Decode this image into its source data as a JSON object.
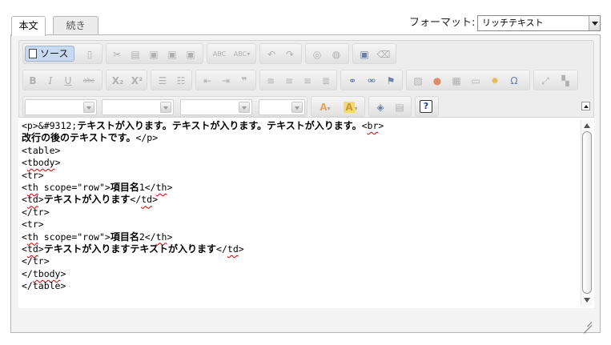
{
  "tabs": [
    {
      "label": "本文",
      "active": true
    },
    {
      "label": "続き",
      "active": false
    }
  ],
  "format": {
    "label": "フォーマット:",
    "selected": "リッチテキスト"
  },
  "toolbar": {
    "source_label": "ソース",
    "row1_icons": [
      "source-icon",
      "new-page-icon",
      "cut-icon",
      "copy-icon",
      "paste-icon",
      "paste-text-icon",
      "paste-word-icon",
      "spellcheck-icon",
      "spellcheck-options-icon",
      "undo-icon",
      "redo-icon",
      "find-icon",
      "replace-icon",
      "select-all-icon",
      "remove-format-icon"
    ],
    "row2_icons": [
      "bold-icon",
      "italic-icon",
      "underline-icon",
      "strikethrough-icon",
      "subscript-icon",
      "superscript-icon",
      "numbered-list-icon",
      "bullet-list-icon",
      "outdent-icon",
      "indent-icon",
      "blockquote-icon",
      "align-left-icon",
      "align-center-icon",
      "align-right-icon",
      "justify-icon",
      "link-icon",
      "unlink-icon",
      "anchor-icon",
      "image-icon",
      "flash-icon",
      "table-icon",
      "horizontal-rule-icon",
      "special-char-icon",
      "omega-icon",
      "maximize-icon",
      "show-blocks-icon"
    ],
    "row3_icons": [
      "text-color-icon",
      "bg-color-icon",
      "maximize2-icon",
      "show-blocks2-icon",
      "about-icon"
    ],
    "text_color_glyph": "A",
    "bg_color_glyph": "A",
    "about_glyph": "?",
    "omega_glyph": "Ω"
  },
  "source_lines": [
    [
      {
        "t": "<p>&#9312;"
      },
      {
        "t": "テキストが入ります。テキストが入ります。テキストが入ります。",
        "b": true
      },
      {
        "t": "<"
      },
      {
        "t": "br",
        "sq": true
      },
      {
        "t": ">"
      }
    ],
    [
      {
        "t": "改行の後のテキストです。",
        "b": true
      },
      {
        "t": "</p>"
      }
    ],
    [
      {
        "t": "<table>"
      }
    ],
    [
      {
        "t": "<"
      },
      {
        "t": "tbody",
        "sq": true
      },
      {
        "t": ">"
      }
    ],
    [
      {
        "t": "<tr>"
      }
    ],
    [
      {
        "t": "<"
      },
      {
        "t": "th",
        "sq": true
      },
      {
        "t": " scope=\"row\">"
      },
      {
        "t": "項目名",
        "b": true
      },
      {
        "t": "1</"
      },
      {
        "t": "th",
        "sq": true
      },
      {
        "t": ">"
      }
    ],
    [
      {
        "t": "<"
      },
      {
        "t": "td",
        "sq": true
      },
      {
        "t": ">"
      },
      {
        "t": "テキストが入ります",
        "b": true
      },
      {
        "t": "</"
      },
      {
        "t": "td",
        "sq": true
      },
      {
        "t": ">"
      }
    ],
    [
      {
        "t": "</tr>"
      }
    ],
    [
      {
        "t": "<tr>"
      }
    ],
    [
      {
        "t": "<"
      },
      {
        "t": "th",
        "sq": true
      },
      {
        "t": " scope=\"row\">"
      },
      {
        "t": "項目名",
        "b": true
      },
      {
        "t": "2</"
      },
      {
        "t": "th",
        "sq": true
      },
      {
        "t": ">"
      }
    ],
    [
      {
        "t": "<"
      },
      {
        "t": "td",
        "sq": true
      },
      {
        "t": ">"
      },
      {
        "t": "テキストが入りますテキストが入ります",
        "b": true
      },
      {
        "t": "</"
      },
      {
        "t": "td",
        "sq": true
      },
      {
        "t": ">"
      }
    ],
    [
      {
        "t": "</tr>"
      }
    ],
    [
      {
        "t": "</"
      },
      {
        "t": "tbody",
        "sq": true
      },
      {
        "t": ">"
      }
    ],
    [
      {
        "t": "</table>"
      }
    ]
  ]
}
